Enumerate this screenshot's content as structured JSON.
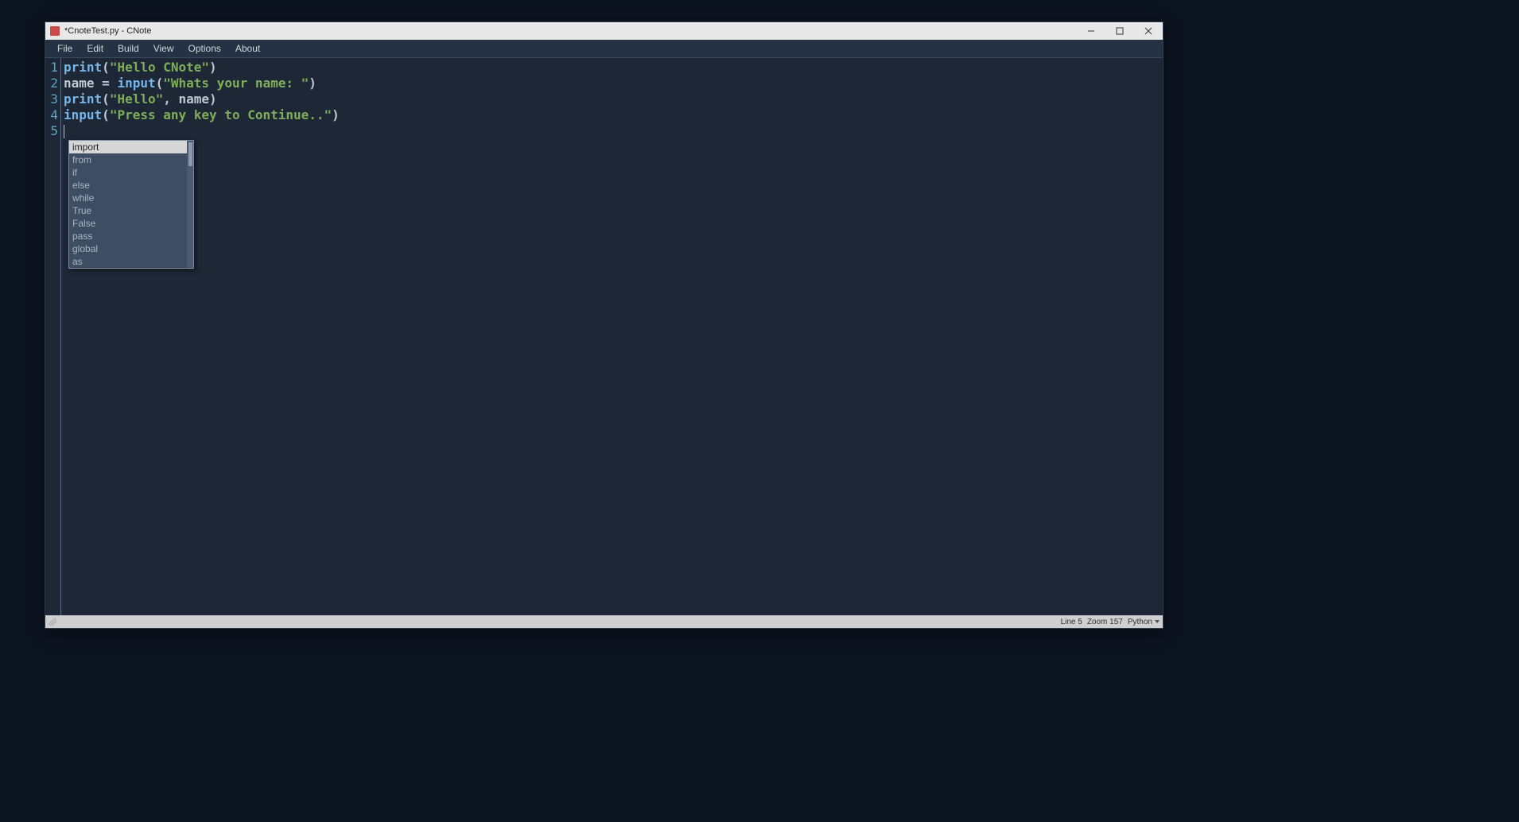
{
  "window": {
    "title": "*CnoteTest.py - CNote"
  },
  "menubar": {
    "items": [
      "File",
      "Edit",
      "Build",
      "View",
      "Options",
      "About"
    ]
  },
  "code": {
    "lines": [
      {
        "num": "1",
        "tokens": [
          {
            "t": "print",
            "c": "fn"
          },
          {
            "t": "(",
            "c": "punct"
          },
          {
            "t": "\"Hello CNote\"",
            "c": "str"
          },
          {
            "t": ")",
            "c": "punct"
          }
        ]
      },
      {
        "num": "2",
        "tokens": [
          {
            "t": "name ",
            "c": "var"
          },
          {
            "t": "= ",
            "c": "op"
          },
          {
            "t": "input",
            "c": "fn"
          },
          {
            "t": "(",
            "c": "punct"
          },
          {
            "t": "\"Whats your name: \"",
            "c": "str"
          },
          {
            "t": ")",
            "c": "punct"
          }
        ]
      },
      {
        "num": "3",
        "tokens": [
          {
            "t": "print",
            "c": "fn"
          },
          {
            "t": "(",
            "c": "punct"
          },
          {
            "t": "\"Hello\"",
            "c": "str"
          },
          {
            "t": ", ",
            "c": "punct"
          },
          {
            "t": "name",
            "c": "var"
          },
          {
            "t": ")",
            "c": "punct"
          }
        ]
      },
      {
        "num": "4",
        "tokens": [
          {
            "t": "input",
            "c": "fn"
          },
          {
            "t": "(",
            "c": "punct"
          },
          {
            "t": "\"Press any key to Continue..\"",
            "c": "str"
          },
          {
            "t": ")",
            "c": "punct"
          }
        ]
      },
      {
        "num": "5",
        "tokens": []
      }
    ]
  },
  "autocomplete": {
    "items": [
      "import",
      "from",
      "if",
      "else",
      "while",
      "True",
      "False",
      "pass",
      "global",
      "as"
    ],
    "selected_index": 0
  },
  "statusbar": {
    "line": "Line 5",
    "zoom": "Zoom 157",
    "language": "Python"
  }
}
